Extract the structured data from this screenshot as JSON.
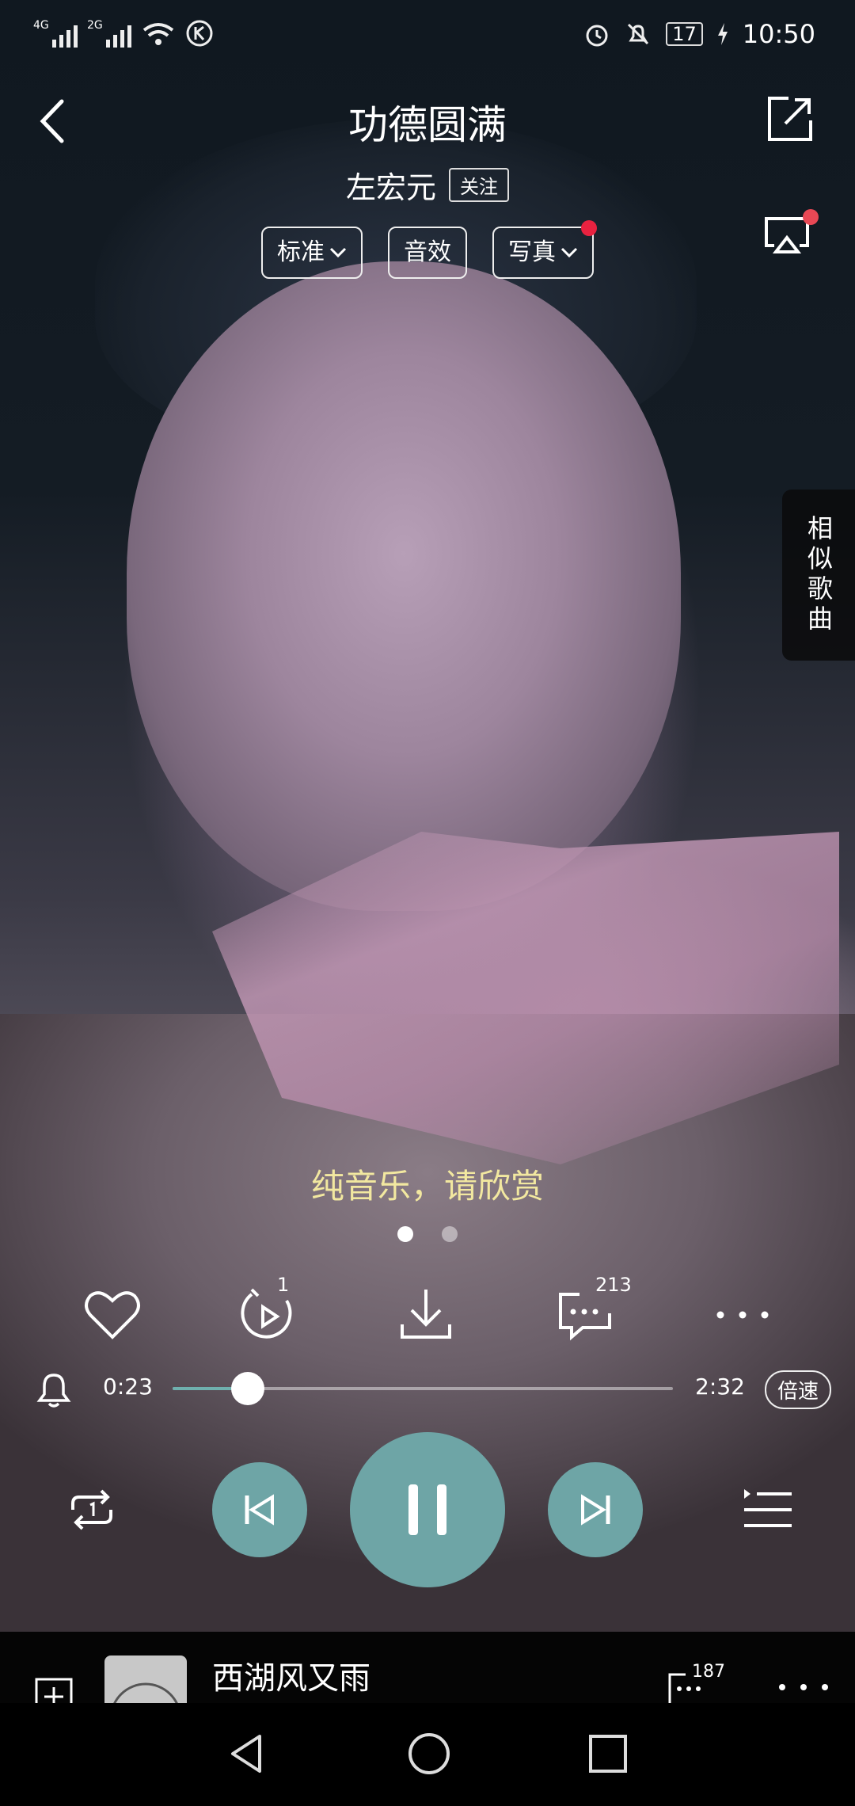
{
  "status_bar": {
    "net1": "4G",
    "net2": "2G",
    "battery": "17",
    "time": "10:50"
  },
  "header": {
    "title": "功德圆满",
    "artist": "左宏元",
    "follow_label": "关注"
  },
  "chips": [
    {
      "label": "标准",
      "has_dropdown": true
    },
    {
      "label": "音效",
      "has_dropdown": false
    },
    {
      "label": "写真",
      "has_dropdown": true,
      "has_red_dot": true
    }
  ],
  "side_tab": {
    "label": "相似歌曲"
  },
  "lyric": "纯音乐，请欣赏",
  "pager": {
    "count": 2,
    "active": 0
  },
  "actions": {
    "like": {
      "icon": "heart-icon"
    },
    "playtimes": {
      "icon": "vinyl-play-icon",
      "badge": "1"
    },
    "download": {
      "icon": "download-icon"
    },
    "comments": {
      "icon": "comment-icon",
      "badge": "213"
    },
    "more": {
      "icon": "more-icon"
    }
  },
  "progress": {
    "current": "0:23",
    "total": "2:32",
    "fraction": 0.151,
    "speed_label": "倍速"
  },
  "colors": {
    "accent": "#6ea5a6",
    "progress_fill": "#6fb0ae",
    "lyric": "#f2e8a0",
    "red_dot": "#e82240"
  },
  "mini_player": {
    "song": "西湖风又雨",
    "comment_badge": "187"
  }
}
